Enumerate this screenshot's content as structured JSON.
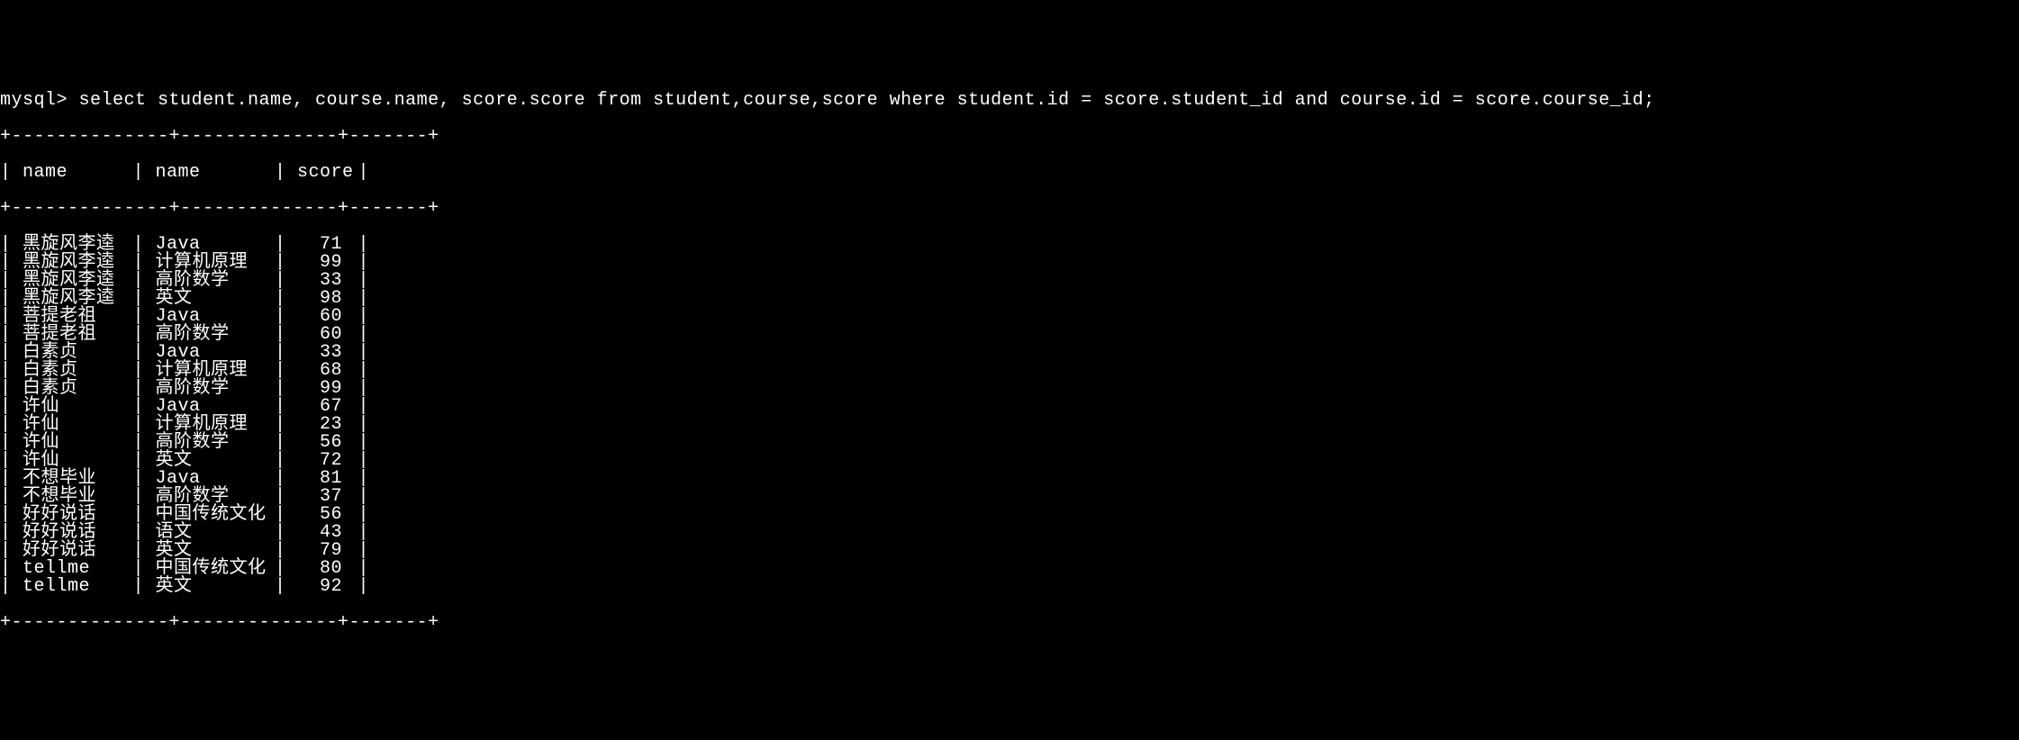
{
  "prompt": "mysql> select student.name, course.name, score.score from student,course,score where student.id = score.student_id and course.id = score.course_id;",
  "border_top": "+--------------+--------------+-------+",
  "header": {
    "col1": " name",
    "col2": " name",
    "col3": " score "
  },
  "border_mid": "+--------------+--------------+-------+",
  "rows": [
    {
      "student": " 黑旋风李逵",
      "course": " Java",
      "score": "71 "
    },
    {
      "student": " 黑旋风李逵",
      "course": " 计算机原理",
      "score": "99 "
    },
    {
      "student": " 黑旋风李逵",
      "course": " 高阶数学",
      "score": "33 "
    },
    {
      "student": " 黑旋风李逵",
      "course": " 英文",
      "score": "98 "
    },
    {
      "student": " 菩提老祖",
      "course": " Java",
      "score": "60 "
    },
    {
      "student": " 菩提老祖",
      "course": " 高阶数学",
      "score": "60 "
    },
    {
      "student": " 白素贞",
      "course": " Java",
      "score": "33 "
    },
    {
      "student": " 白素贞",
      "course": " 计算机原理",
      "score": "68 "
    },
    {
      "student": " 白素贞",
      "course": " 高阶数学",
      "score": "99 "
    },
    {
      "student": " 许仙",
      "course": " Java",
      "score": "67 "
    },
    {
      "student": " 许仙",
      "course": " 计算机原理",
      "score": "23 "
    },
    {
      "student": " 许仙",
      "course": " 高阶数学",
      "score": "56 "
    },
    {
      "student": " 许仙",
      "course": " 英文",
      "score": "72 "
    },
    {
      "student": " 不想毕业",
      "course": " Java",
      "score": "81 "
    },
    {
      "student": " 不想毕业",
      "course": " 高阶数学",
      "score": "37 "
    },
    {
      "student": " 好好说话",
      "course": " 中国传统文化",
      "score": "56 "
    },
    {
      "student": " 好好说话",
      "course": " 语文",
      "score": "43 "
    },
    {
      "student": " 好好说话",
      "course": " 英文",
      "score": "79 "
    },
    {
      "student": " tellme",
      "course": " 中国传统文化",
      "score": "80 "
    },
    {
      "student": " tellme",
      "course": " 英文",
      "score": "92 "
    }
  ],
  "border_bot": "+--------------+--------------+-------+",
  "pipe": "|"
}
